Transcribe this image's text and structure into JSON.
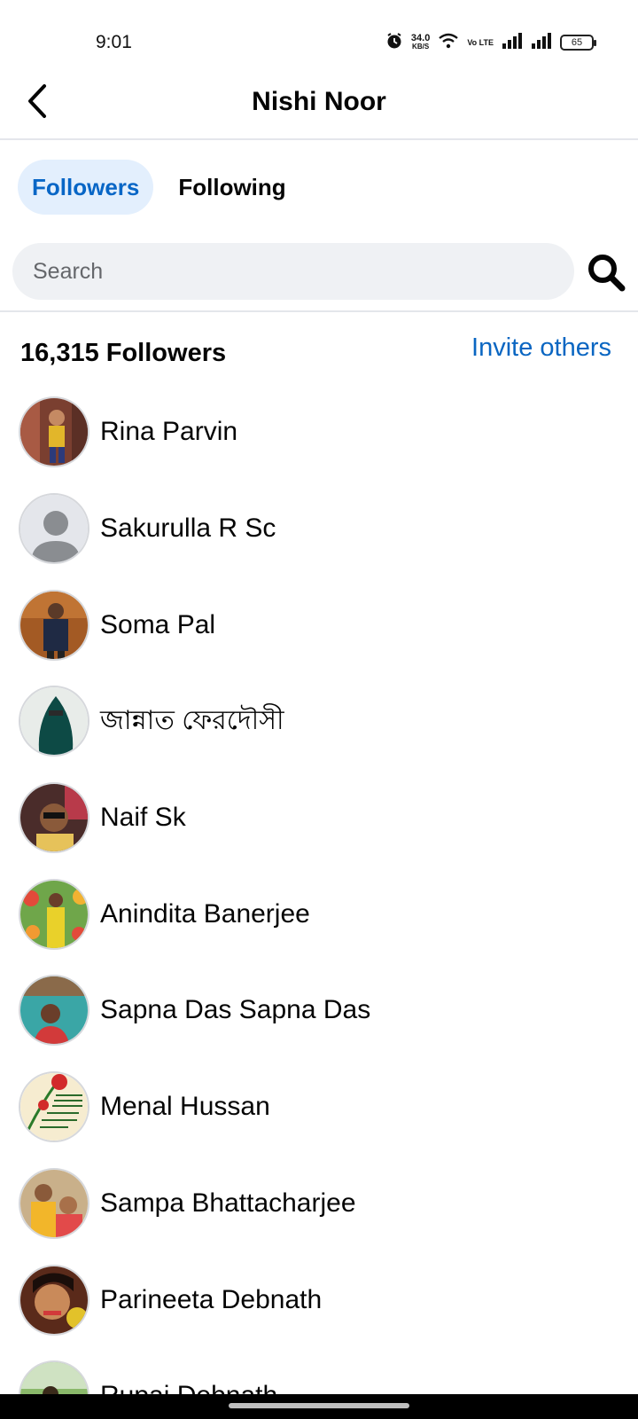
{
  "status_bar": {
    "time": "9:01",
    "net_speed_value": "34.0",
    "net_speed_unit": "KB/S",
    "volte": "Vo LTE",
    "battery": "65"
  },
  "header": {
    "title": "Nishi Noor",
    "back_icon": "chevron-left-icon"
  },
  "tabs": [
    {
      "label": "Followers",
      "active": true
    },
    {
      "label": "Following",
      "active": false
    }
  ],
  "search": {
    "placeholder": "Search",
    "value": "",
    "icon": "search-icon"
  },
  "followers": {
    "count_label": "16,315 Followers",
    "invite_label": "Invite others",
    "items": [
      {
        "name": "Rina Parvin"
      },
      {
        "name": "Sakurulla R Sc"
      },
      {
        "name": "Soma Pal"
      },
      {
        "name": "জান্নাত ফেরদৌসী"
      },
      {
        "name": "Naif Sk"
      },
      {
        "name": "Anindita Banerjee"
      },
      {
        "name": "Sapna Das Sapna Das"
      },
      {
        "name": "Menal Hussan"
      },
      {
        "name": "Sampa Bhattacharjee"
      },
      {
        "name": "Parineeta Debnath"
      },
      {
        "name": "Rupai Debnath"
      }
    ]
  },
  "colors": {
    "accent": "#0866c6",
    "tab_active_bg": "#e3effd",
    "search_bg": "#eff1f4",
    "divider": "#e4e6eb"
  }
}
